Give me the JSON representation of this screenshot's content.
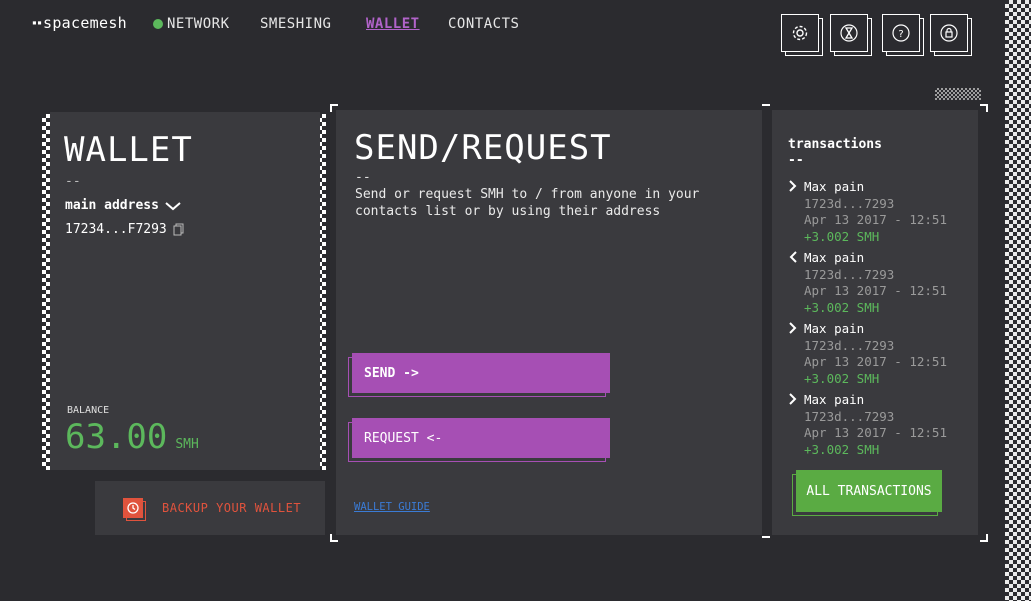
{
  "header": {
    "logo_mark": "▪▪",
    "logo_text": "spacemesh",
    "nav": {
      "network": "NETWORK",
      "smeshing": "SMESHING",
      "wallet": "WALLET",
      "contacts": "CONTACTS"
    },
    "network_status_color": "#5cb85c",
    "icons": [
      "gear-icon",
      "hourglass-icon",
      "help-icon",
      "lock-icon"
    ]
  },
  "wallet_panel": {
    "title": "WALLET",
    "dash": "--",
    "account_label": "main address",
    "address": "17234...F7293",
    "balance_label": "BALANCE",
    "balance_value": "63.00",
    "balance_unit": "SMH"
  },
  "backup": {
    "label": "BACKUP YOUR WALLET"
  },
  "send_panel": {
    "title": "SEND/REQUEST",
    "dash": "--",
    "description": "Send or request SMH to / from anyone in your contacts list or by using their address",
    "send_label": "SEND ->",
    "request_label": "REQUEST <-",
    "guide_link": "WALLET GUIDE"
  },
  "transactions": {
    "title": "transactions",
    "dash": "--",
    "items": [
      {
        "direction": "out",
        "name": "Max pain",
        "address": "1723d...7293",
        "date": "Apr 13 2017 - 12:51",
        "amount": "+3.002 SMH"
      },
      {
        "direction": "in",
        "name": "Max pain",
        "address": "1723d...7293",
        "date": "Apr 13 2017 - 12:51",
        "amount": "+3.002 SMH"
      },
      {
        "direction": "out",
        "name": "Max pain",
        "address": "1723d...7293",
        "date": "Apr 13 2017 - 12:51",
        "amount": "+3.002 SMH"
      },
      {
        "direction": "out",
        "name": "Max pain",
        "address": "1723d...7293",
        "date": "Apr 13 2017 - 12:51",
        "amount": "+3.002 SMH"
      }
    ],
    "all_button": "ALL TRANSACTIONS"
  },
  "colors": {
    "accent_purple": "#a64fb4",
    "accent_green": "#5aab43",
    "backup_red": "#e0533d",
    "link_blue": "#3a7bd5"
  }
}
